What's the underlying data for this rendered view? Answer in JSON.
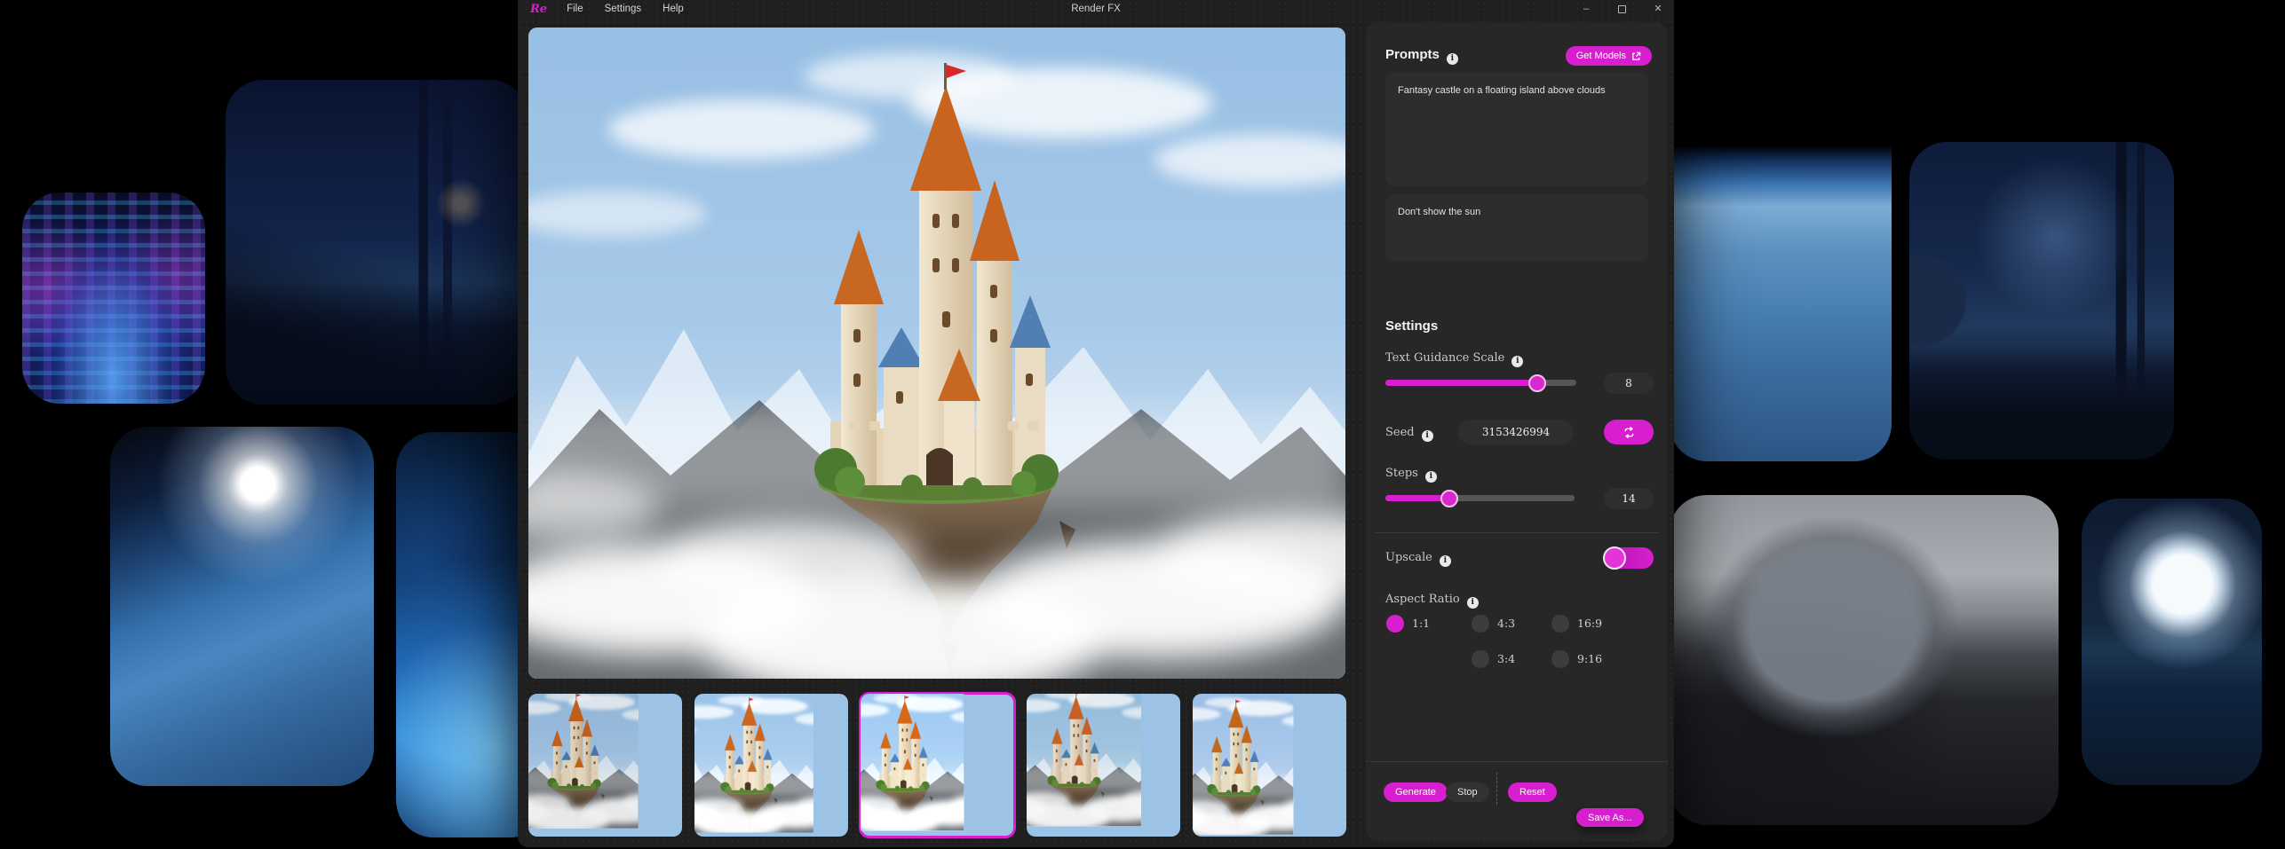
{
  "window": {
    "logo_text": "Re",
    "title": "Render FX",
    "menus": [
      "File",
      "Settings",
      "Help"
    ],
    "icons": {
      "minimize": "–",
      "close": "✕"
    }
  },
  "prompts": {
    "heading": "Prompts",
    "get_models_label": "Get Models",
    "positive_prompt": "Fantasy castle on a floating island above clouds",
    "negative_prompt": "Don't show the sun"
  },
  "settings_panel": {
    "heading": "Settings",
    "text_guidance_scale": {
      "label": "Text Guidance Scale",
      "value": "8"
    },
    "seed": {
      "label": "Seed",
      "value": "3153426994"
    },
    "steps": {
      "label": "Steps",
      "value": "14"
    },
    "upscale": {
      "label": "Upscale",
      "enabled": true
    },
    "aspect_ratio": {
      "label": "Aspect Ratio",
      "selected": "1:1",
      "options": [
        "1:1",
        "4:3",
        "16:9",
        "3:4",
        "9:16"
      ]
    }
  },
  "actions": {
    "generate": "Generate",
    "stop": "Stop",
    "reset": "Reset",
    "save_as": "Save As..."
  },
  "gallery": {
    "selected_index": 2,
    "count": 5
  },
  "accent_color": "#d81fd0",
  "background_gallery": [
    "cyberpunk-control-room",
    "futuristic-city-night",
    "earth-orbit-sunrise",
    "blue-ice-cave",
    "robot-satellite-over-earth",
    "alien-planet-city",
    "spaceship-on-moon",
    "full-moon-over-ocean"
  ]
}
